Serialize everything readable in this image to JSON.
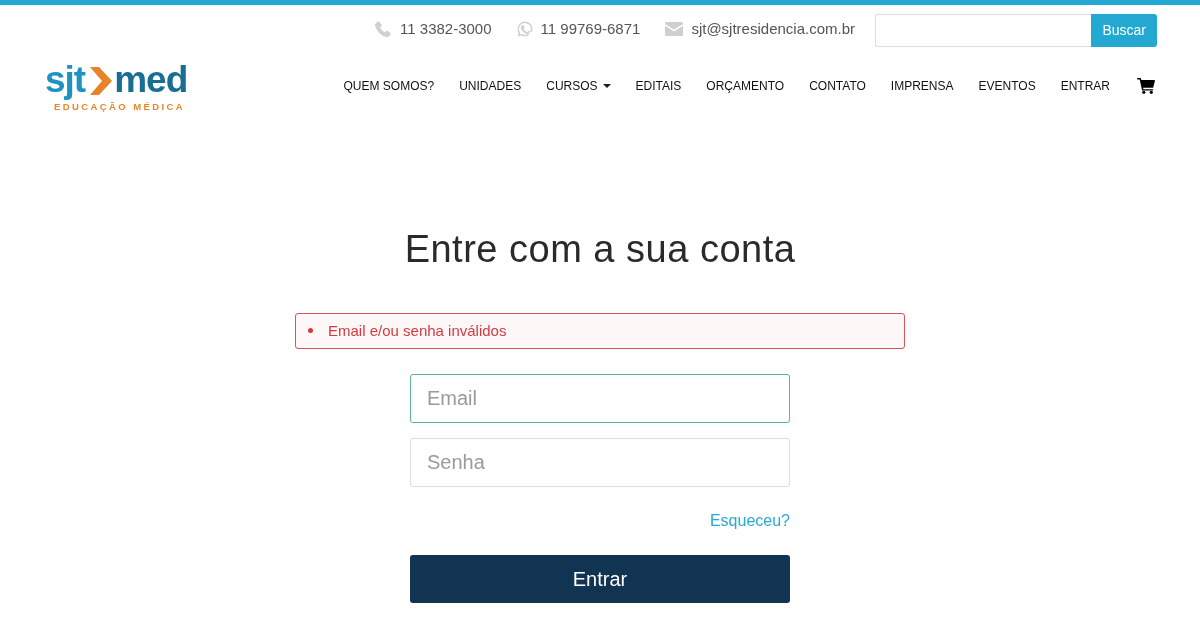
{
  "topbar": {
    "contacts": [
      {
        "kind": "phone",
        "text": "11 3382-3000"
      },
      {
        "kind": "whatsapp",
        "text": "11 99769-6871"
      },
      {
        "kind": "email",
        "text": "sjt@sjtresidencia.com.br"
      }
    ],
    "search": {
      "button": "Buscar"
    }
  },
  "logo": {
    "left": "sjt",
    "right": "med",
    "tagline": "EDUCAÇÃO MÉDICA"
  },
  "nav": {
    "items": [
      {
        "label": "QUEM SOMOS?",
        "dropdown": false
      },
      {
        "label": "UNIDADES",
        "dropdown": false
      },
      {
        "label": "CURSOS",
        "dropdown": true
      },
      {
        "label": "EDITAIS",
        "dropdown": false
      },
      {
        "label": "ORÇAMENTO",
        "dropdown": false
      },
      {
        "label": "CONTATO",
        "dropdown": false
      },
      {
        "label": "IMPRENSA",
        "dropdown": false
      },
      {
        "label": "EVENTOS",
        "dropdown": false
      },
      {
        "label": "ENTRAR",
        "dropdown": false
      }
    ]
  },
  "login": {
    "title": "Entre com a sua conta",
    "errors": [
      "Email e/ou senha inválidos"
    ],
    "fields": [
      {
        "placeholder": "Email",
        "focused": true
      },
      {
        "placeholder": "Senha",
        "focused": false
      }
    ],
    "forgot_link": "Esqueceu?",
    "submit": "Entrar"
  }
}
